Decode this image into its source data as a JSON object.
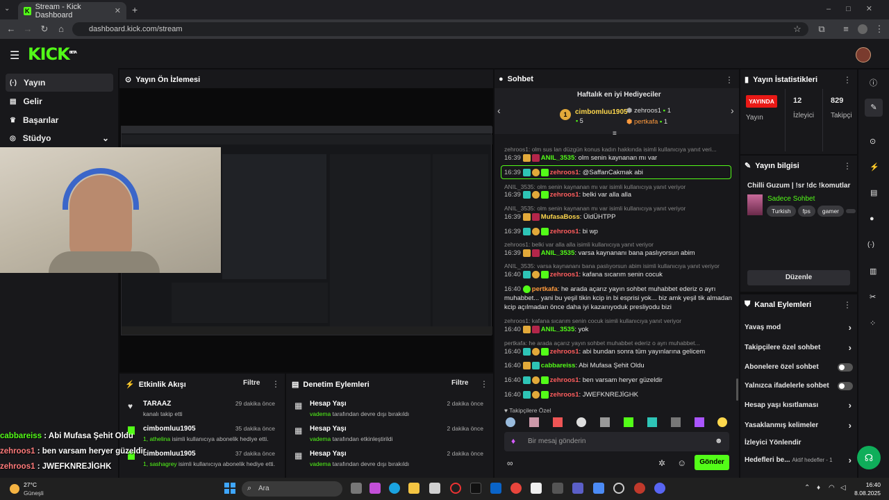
{
  "browser": {
    "tab_title": "Stream - Kick Dashboard",
    "url": "dashboard.kick.com/stream"
  },
  "kick": {
    "logo": "KICK",
    "logo_sup": "BETA"
  },
  "sidebar": {
    "items": [
      {
        "label": "Yayın",
        "icon": "broadcast-icon"
      },
      {
        "label": "Gelir",
        "icon": "revenue-icon"
      },
      {
        "label": "Başarılar",
        "icon": "trophy-icon"
      },
      {
        "label": "Stüdyo",
        "icon": "studio-icon"
      }
    ]
  },
  "preview": {
    "title": "Yayın Ön İzlemesi"
  },
  "activity": {
    "title": "Etkinlik Akışı",
    "filter": "Filtre",
    "items": [
      {
        "name": "TARAAZ",
        "sub": "kanalı takip etti",
        "time": "29 dakika önce"
      },
      {
        "name": "cimbomluu1905",
        "sub_green": "1, athelina",
        "sub": " isimli kullanıcıya abonelik hediye etti.",
        "time": "35 dakika önce"
      },
      {
        "name": "cimbomluu1905",
        "sub_green": "1, sashagrey",
        "sub": " isimli kullanıcıya abonelik hediye etti.",
        "time": "37 dakika önce"
      }
    ]
  },
  "moderation": {
    "title": "Denetim Eylemleri",
    "filter": "Filtre",
    "items": [
      {
        "name": "Hesap Yaşı",
        "user": "vadema",
        "sub": " tarafından devre dışı bırakıldı",
        "time": "2 dakika önce"
      },
      {
        "name": "Hesap Yaşı",
        "user": "vadema",
        "sub": " tarafından etkinleştirildi",
        "time": "2 dakika önce"
      },
      {
        "name": "Hesap Yaşı",
        "user": "vadema",
        "sub": " tarafından devre dışı bırakıldı",
        "time": "2 dakika önce"
      }
    ]
  },
  "chat": {
    "title": "Sohbet",
    "gifters_title": "Haftalık en iyi Hediyeciler",
    "gifters": [
      {
        "rank": "1",
        "name": "cimbomluu1905",
        "count": "5"
      },
      {
        "name": "zehroos1",
        "count": "1"
      },
      {
        "name": "pertkafa",
        "count": "1"
      }
    ],
    "messages": [
      {
        "reply": "zehroos1: olm sus lan düzgün konus kadın hakkında isimli kullanıcıya yanıt veri..."
      },
      {
        "time": "16:39",
        "user": "ANIL_3535",
        "color": "#53fc18",
        "text": ": olm senin kaynanan mı var"
      },
      {
        "time": "16:39",
        "user": "zehroos1",
        "color": "#ff5d5d",
        "text": ": @SaffanCakmak abi"
      },
      {
        "reply": "ANIL_3535: olm senin kaynanan mı var isimli kullanıcıya yanıt veriyor"
      },
      {
        "time": "16:39",
        "user": "zehroos1",
        "color": "#ff5d5d",
        "text": ": belki var alla alla"
      },
      {
        "reply": "ANIL_3535: olm senin kaynanan mı var isimli kullanıcıya yanıt veriyor"
      },
      {
        "time": "16:39",
        "user": "MufasaBoss",
        "color": "#ffd84d",
        "text": ": ÜldÜHTPP"
      },
      {
        "time": "16:39",
        "user": "zehroos1",
        "color": "#ff5d5d",
        "text": ": bi wp"
      },
      {
        "reply": "zehroos1: belki var alla alla isimli kullanıcıya yanıt veriyor"
      },
      {
        "time": "16:39",
        "user": "ANIL_3535",
        "color": "#53fc18",
        "text": ": varsa kaynananı bana paslıyorsun abim"
      },
      {
        "reply": "ANIL_3535: varsa kaynananı bana paslıyorsun abim isimli kullanıcıya yanıt veriyor"
      },
      {
        "time": "16:40",
        "user": "zehroos1",
        "color": "#ff5d5d",
        "text": ": kafana sıcarım senin cocuk"
      },
      {
        "time": "16:40",
        "user": "pertkafa",
        "color": "#ff9a3d",
        "text": ": he arada açarız yayın sohbet muhabbet ederiz o ayrı muhabbet... yani bu yeşil tikin kcip in bi esprisi yok... biz amk yeşil tik almadan kcip açılmadan önce daha iyi kazanıyoduk presliyodu bizi"
      },
      {
        "reply": "zehroos1: kafana sıcarım senin cocuk isimli kullanıcıya yanıt veriyor"
      },
      {
        "time": "16:40",
        "user": "ANIL_3535",
        "color": "#53fc18",
        "text": ": yok"
      },
      {
        "reply": "pertkafa: he arada açarız yayın sohbet muhabbet ederiz o ayrı muhabbet... "
      },
      {
        "time": "16:40",
        "user": "zehroos1",
        "color": "#ff5d5d",
        "text": ": abi bundan sonra tüm yayınlarına gelicem"
      },
      {
        "time": "16:40",
        "user": "cabbareiss",
        "color": "#53fc18",
        "text": ": Abi Mufasa Şehit Oldu"
      },
      {
        "time": "16:40",
        "user": "zehroos1",
        "color": "#ff5d5d",
        "text": ": ben varsam heryer güzeldir"
      },
      {
        "time": "16:40",
        "user": "zehroos1",
        "color": "#ff5d5d",
        "text": ": JWEFKNREJİGHK"
      }
    ],
    "followers_label": "Takipçilere Özel",
    "input_placeholder": "Bir mesaj gönderin",
    "send": "Gönder"
  },
  "stats": {
    "title": "Yayın İstatistikleri",
    "live_badge": "YAYINDA",
    "live_label": "Yayın",
    "viewers": "12",
    "viewers_label": "İzleyici",
    "followers": "829",
    "followers_label": "Takipçi"
  },
  "info": {
    "title": "Yayın bilgisi",
    "stream_title": "Chilli Guzum | !sr !dc !komutlar",
    "category": "Sadece Sohbet",
    "tags": [
      "Turkish",
      "fps",
      "gamer"
    ],
    "edit": "Düzenle"
  },
  "channel_actions": {
    "title": "Kanal Eylemleri",
    "items": [
      {
        "label": "Yavaş mod",
        "control": "arrow"
      },
      {
        "label": "Takipçilere özel sohbet",
        "control": "arrow"
      },
      {
        "label": "Abonelere özel sohbet",
        "control": "toggle"
      },
      {
        "label": "Yalnızca ifadelerle sohbet",
        "control": "toggle"
      },
      {
        "label": "Hesap yaşı kısıtlaması",
        "control": "arrow"
      },
      {
        "label": "Yasaklanmış kelimeler",
        "control": "arrow"
      },
      {
        "label": "İzleyici Yönlendir",
        "control": "none"
      },
      {
        "label": "Hedefleri be...",
        "extra": "Aktif hedefler - 1",
        "control": "arrow"
      }
    ]
  },
  "overlay": [
    {
      "user": "cabbareiss",
      "text": " : Abi Mufasa Şehit Oldu"
    },
    {
      "user": "zehroos1",
      "text": " : ben varsam heryer güzeldir"
    },
    {
      "user": "zehroos1",
      "text": " : JWEFKNREJİGHK"
    }
  ],
  "taskbar": {
    "weather_temp": "27°C",
    "weather_desc": "Güneşli",
    "search": "Ara",
    "time": "16:40",
    "date": "8.08.2025"
  },
  "colors": {
    "accent": "#53fc18",
    "bg": "#0e0e10",
    "panel": "#18181b",
    "live": "#e91916"
  }
}
